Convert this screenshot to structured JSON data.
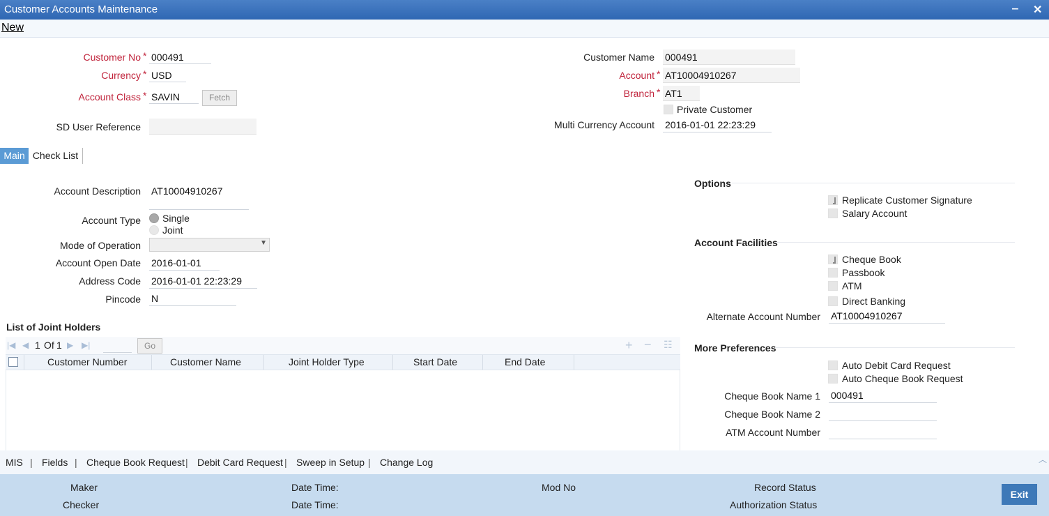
{
  "window": {
    "title": "Customer Accounts Maintenance",
    "minimize": "‒",
    "close": "✕"
  },
  "toolbar": {
    "new_label": "New"
  },
  "header": {
    "customer_no_label": "Customer No",
    "customer_no": "000491",
    "currency_label": "Currency",
    "currency": "USD",
    "account_class_label": "Account Class",
    "account_class": "SAVIN",
    "fetch_label": "Fetch",
    "sd_user_ref_label": "SD User Reference",
    "sd_user_ref": "",
    "customer_name_label": "Customer Name",
    "customer_name": "000491",
    "account_label": "Account",
    "account": "AT10004910267",
    "branch_label": "Branch",
    "branch": "AT1",
    "private_customer_label": "Private Customer",
    "multi_currency_label": "Multi Currency Account",
    "multi_currency": "2016-01-01 22:23:29"
  },
  "tabs": {
    "main": "Main",
    "checklist": "Check List"
  },
  "main": {
    "account_desc_label": "Account Description",
    "account_desc": "AT10004910267",
    "account_type_label": "Account Type",
    "single_label": "Single",
    "joint_label": "Joint",
    "mode_label": "Mode of Operation",
    "mode_value": "",
    "open_date_label": "Account Open Date",
    "open_date": "2016-01-01",
    "address_code_label": "Address Code",
    "address_code": "2016-01-01 22:23:29",
    "pincode_label": "Pincode",
    "pincode": "N"
  },
  "joint": {
    "title": "List of Joint Holders",
    "pager": {
      "current": "1",
      "of": "Of",
      "total": "1",
      "go": "Go"
    },
    "columns": [
      "Customer Number",
      "Customer Name",
      "Joint Holder Type",
      "Start Date",
      "End Date"
    ]
  },
  "options": {
    "title": "Options",
    "replicate_sig": "Replicate Customer Signature",
    "salary_account": "Salary Account"
  },
  "facilities": {
    "title": "Account Facilities",
    "cheque_book": "Cheque Book",
    "passbook": "Passbook",
    "atm": "ATM",
    "direct_banking": "Direct Banking",
    "alt_acc_label": "Alternate Account Number",
    "alt_acc": "AT10004910267"
  },
  "prefs": {
    "title": "More Preferences",
    "auto_debit": "Auto Debit Card Request",
    "auto_cheque": "Auto Cheque Book Request",
    "cb_name1_label": "Cheque Book Name 1",
    "cb_name1": "000491",
    "cb_name2_label": "Cheque Book Name 2",
    "cb_name2": "",
    "atm_acc_label": "ATM Account Number",
    "atm_acc": ""
  },
  "links": [
    "MIS",
    "|",
    "Fields",
    "|",
    "Cheque Book Request",
    "|",
    "Debit Card Request",
    "|",
    "Sweep in Setup",
    "|",
    "Change Log"
  ],
  "footer": {
    "maker": "Maker",
    "checker": "Checker",
    "dt1": "Date Time:",
    "dt2": "Date Time:",
    "mod_no": "Mod No",
    "record_status": "Record Status",
    "auth_status": "Authorization Status",
    "exit": "Exit"
  }
}
